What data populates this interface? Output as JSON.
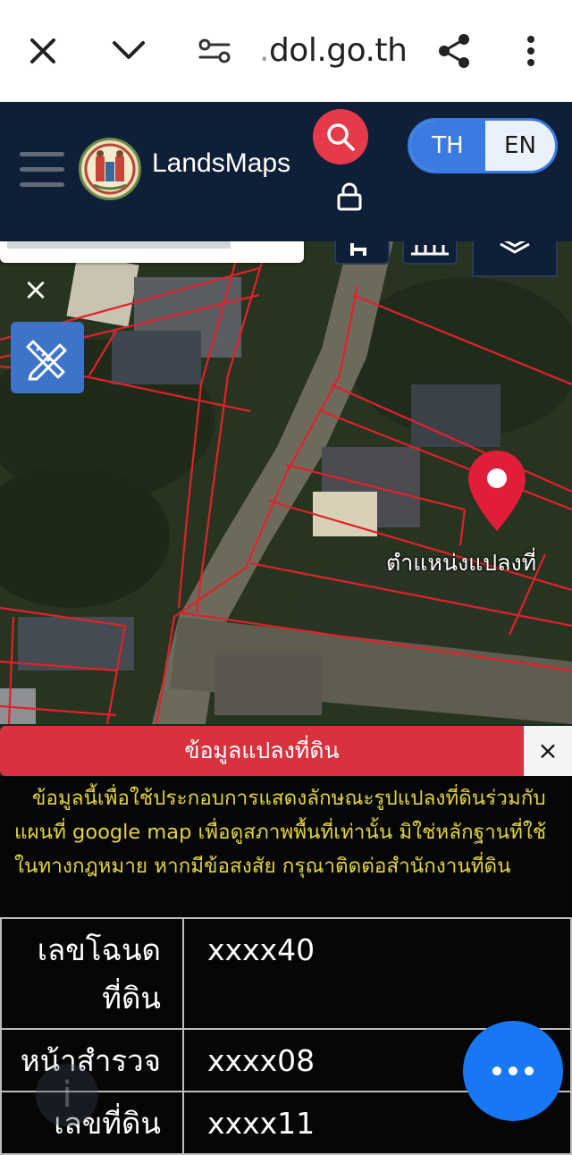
{
  "browser": {
    "url_prefix": ".",
    "url": "dol.go.th"
  },
  "header": {
    "brand": "LandsMaps",
    "lang_th": "TH",
    "lang_en": "EN",
    "accent": "#3a7be0",
    "search_color": "#e53a4a"
  },
  "map": {
    "marker_label": "ตำแหน่งแปลงที่",
    "parcel_line_color": "#e3202b"
  },
  "panel": {
    "title": "ข้อมูลแปลงที่ดิน",
    "close_label": "×",
    "disclaimer": "ข้อมูลนี้เพื่อใช้ประกอบการแสดงลักษณะรูปแปลงที่ดินร่วมกับแผนที่ google map เพื่อดูสภาพพื้นที่เท่านั้น มิใช่หลักฐานที่ใช้ในทางกฎหมาย หากมีข้อสงสัย กรุณาติดต่อสำนักงานที่ดิน",
    "rows": [
      {
        "label": "เลขโฉนดที่ดิน",
        "value": "xxxx40"
      },
      {
        "label": "หน้าสำรวจ",
        "value": "xxxx08"
      },
      {
        "label": "เลขที่ดิน",
        "value": "xxxx11"
      }
    ]
  }
}
